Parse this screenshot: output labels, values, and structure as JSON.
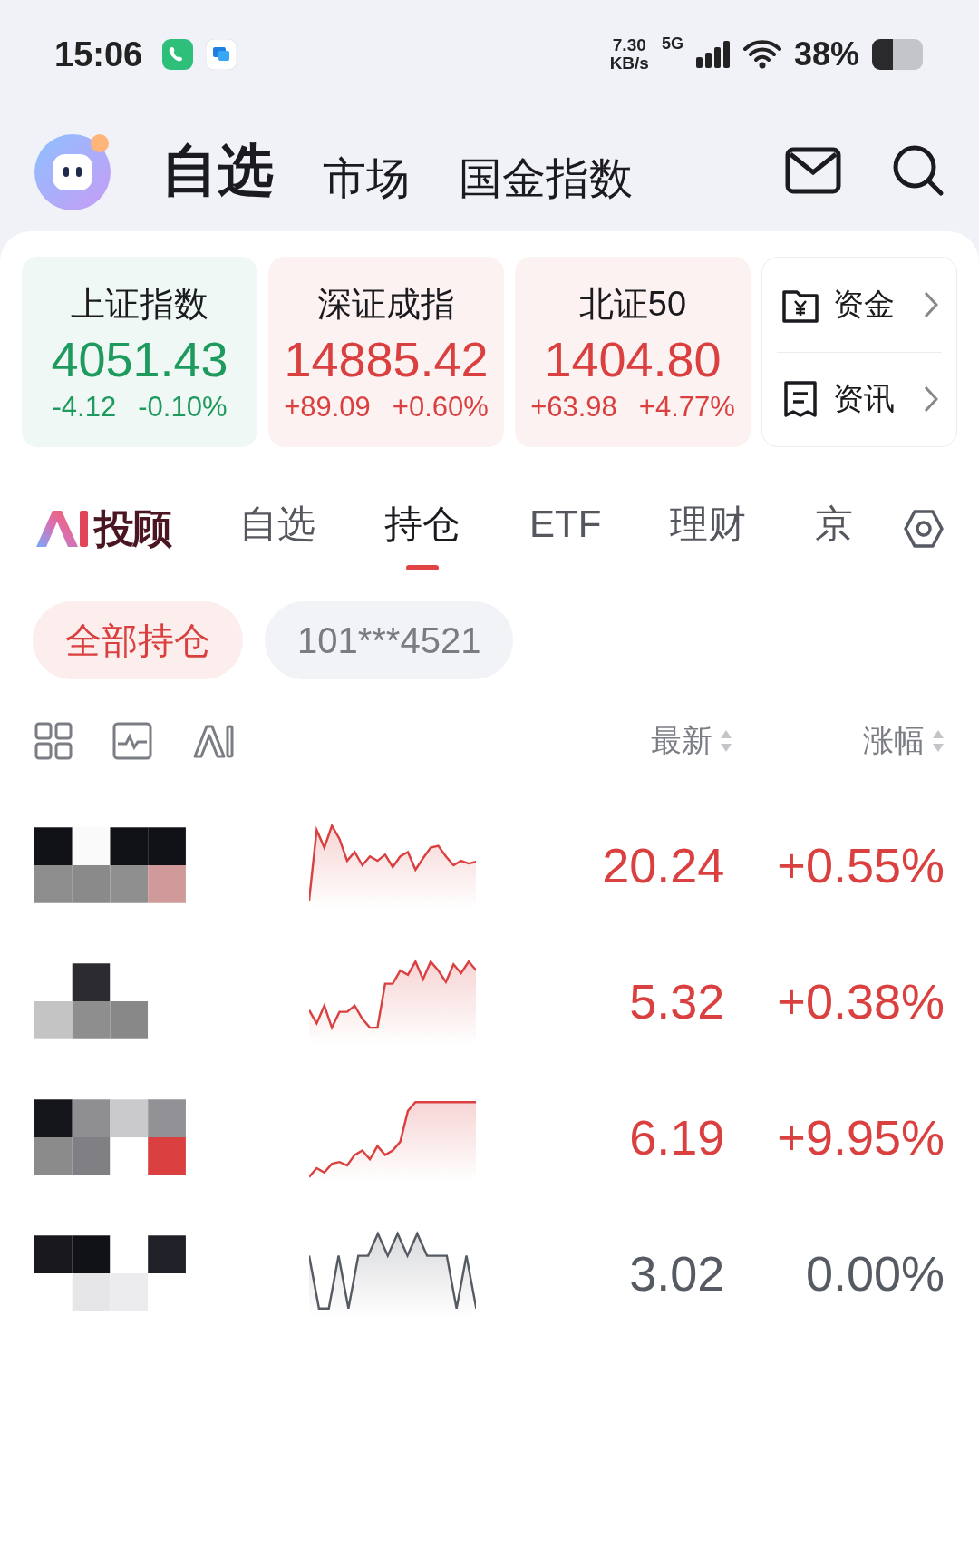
{
  "status_bar": {
    "time": "15:06",
    "speed_value": "7.30",
    "speed_unit": "KB/s",
    "network": "5G",
    "battery": "38%"
  },
  "header": {
    "tabs": [
      {
        "label": "自选",
        "selected": true
      },
      {
        "label": "市场",
        "selected": false
      },
      {
        "label": "国金指数",
        "selected": false
      }
    ]
  },
  "indices": [
    {
      "name": "上证指数",
      "value": "4051.43",
      "change": "-4.12",
      "percent": "-0.10%",
      "color": "#1f9a5e"
    },
    {
      "name": "深证成指",
      "value": "14885.42",
      "change": "+89.09",
      "percent": "+0.60%",
      "color": "#d9403f"
    },
    {
      "name": "北证50",
      "value": "1404.80",
      "change": "+63.98",
      "percent": "+4.77%",
      "color": "#d9403f"
    }
  ],
  "shortcuts": [
    {
      "label": "资金",
      "kind": "fund"
    },
    {
      "label": "资讯",
      "kind": "news"
    }
  ],
  "section_tabs": {
    "brand": "投顾",
    "tabs": [
      {
        "label": "自选",
        "selected": false
      },
      {
        "label": "持仓",
        "selected": true
      },
      {
        "label": "ETF",
        "selected": false
      },
      {
        "label": "理财",
        "selected": false
      },
      {
        "label": "京",
        "selected": false
      }
    ]
  },
  "account_chips": [
    {
      "label": "全部持仓",
      "selected": true
    },
    {
      "label": "101***4521",
      "selected": false
    }
  ],
  "table": {
    "columns": [
      "最新",
      "涨幅"
    ],
    "rows": [
      {
        "price": "20.24",
        "change": "+0.55%",
        "color": "#d9403f"
      },
      {
        "price": "5.32",
        "change": "+0.38%",
        "color": "#d9403f"
      },
      {
        "price": "6.19",
        "change": "+9.95%",
        "color": "#d9403f"
      },
      {
        "price": "3.02",
        "change": "0.00%",
        "color": "#555a63"
      }
    ]
  }
}
